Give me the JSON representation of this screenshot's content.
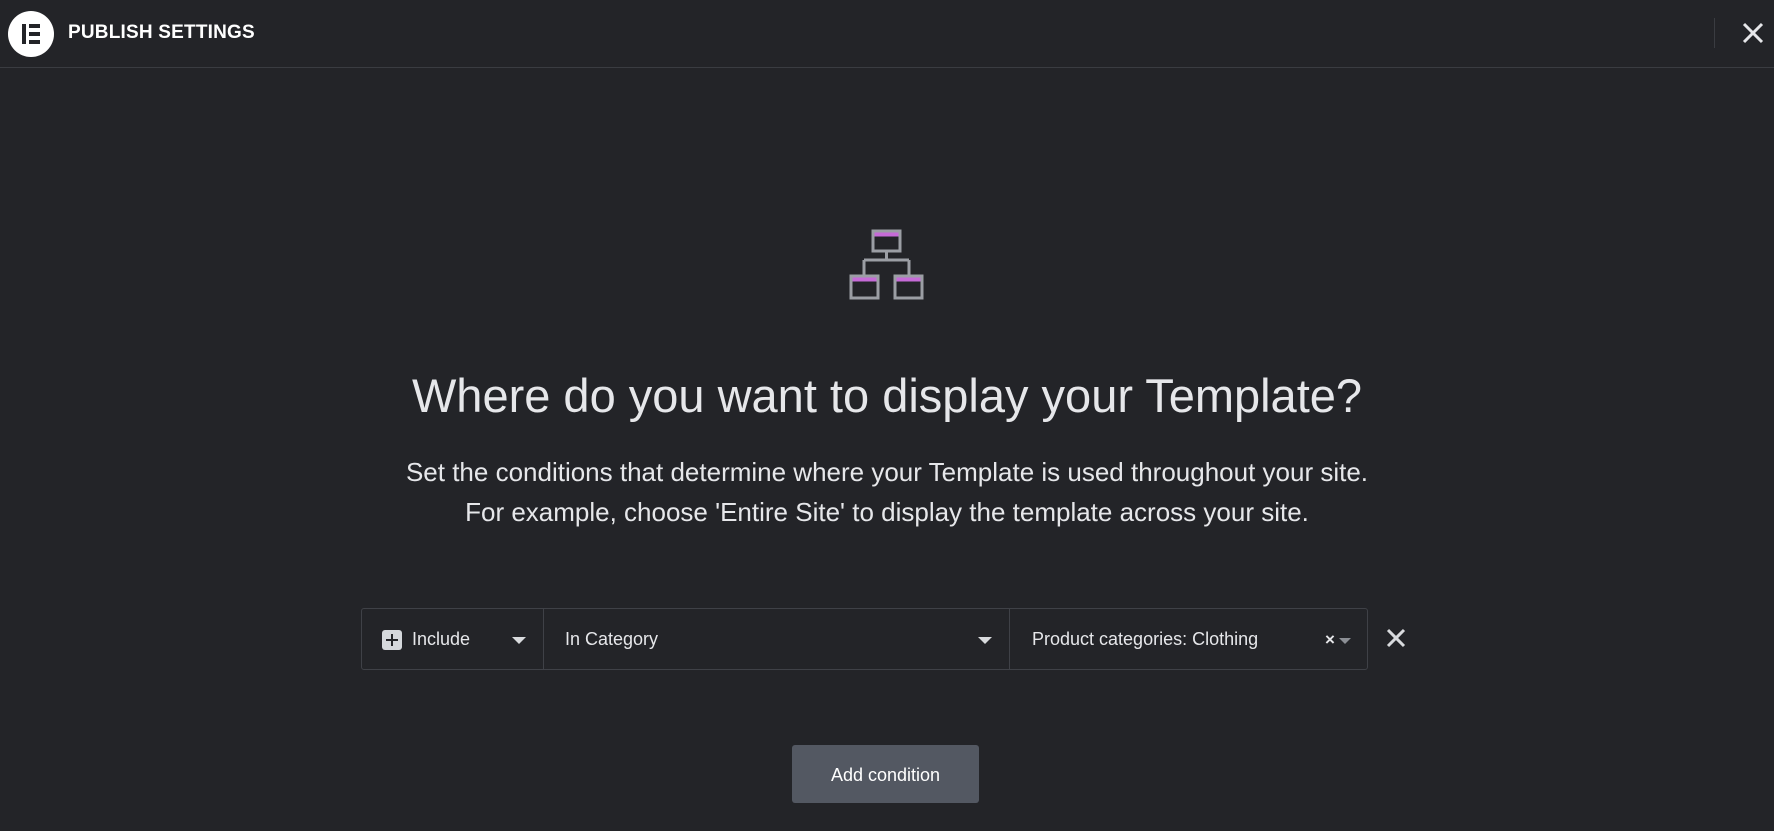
{
  "header": {
    "title": "PUBLISH SETTINGS",
    "logo_icon": "elementor-logo-icon",
    "close_icon": "close-icon"
  },
  "hero": {
    "icon": "sitemap-icon",
    "accent_color": "#c66bd7",
    "heading": "Where do you want to display your Template?",
    "description_line1": "Set the conditions that determine where your Template is used throughout your site.",
    "description_line2": "For example, choose 'Entire Site' to display the template across your site."
  },
  "condition": {
    "type_value": "Include",
    "rule_value": "In Category",
    "target_value": "Product categories: Clothing",
    "clear_symbol": "×"
  },
  "actions": {
    "add_condition_label": "Add condition"
  }
}
